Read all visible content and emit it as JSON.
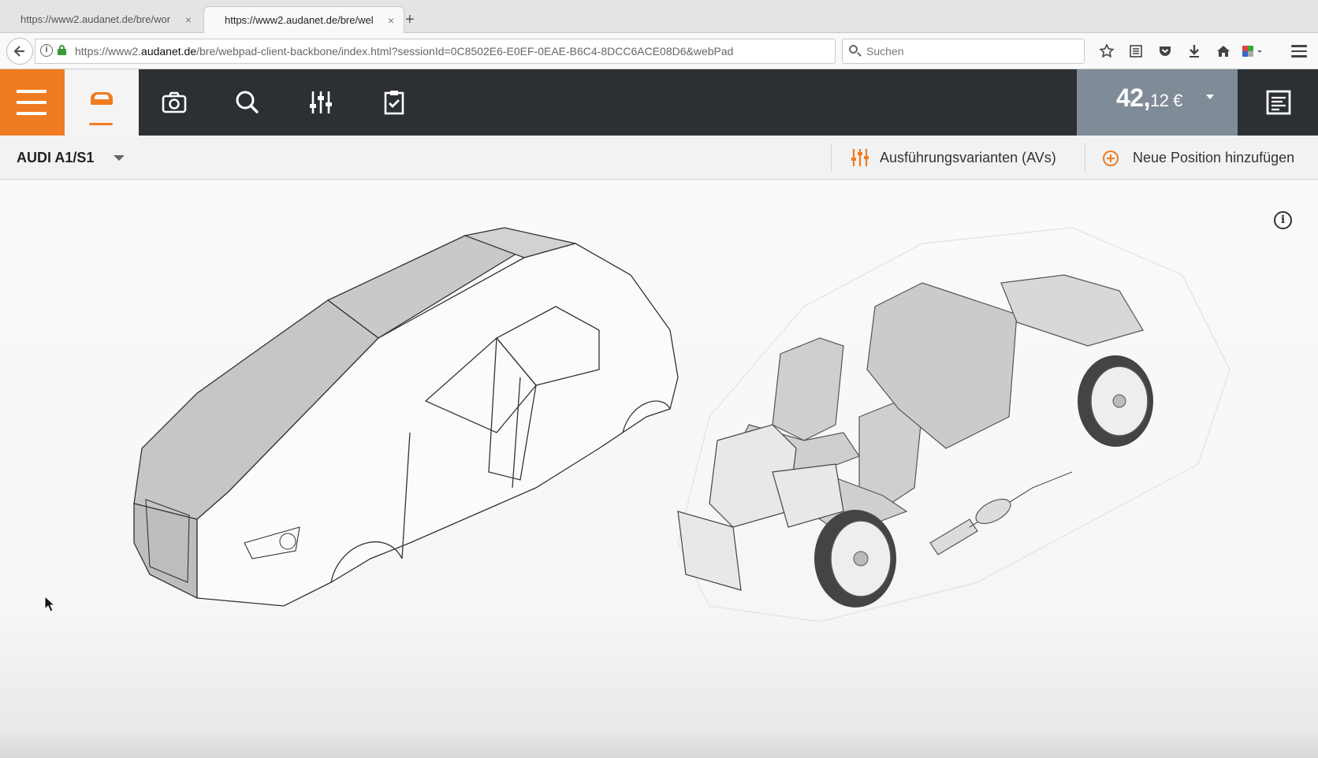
{
  "browser": {
    "tabs": [
      {
        "title": "https://www2.audanet.de/bre/wor",
        "active": false
      },
      {
        "title": "https://www2.audanet.de/bre/wel",
        "active": true
      }
    ],
    "new_tab_glyph": "+",
    "close_glyph": "×",
    "url_prefix": "https://www2.",
    "url_host": "audanet.de",
    "url_rest": "/bre/webpad-client-backbone/index.html?sessionId=0C8502E6-E0EF-0EAE-B6C4-8DCC6ACE08D6&webPad",
    "search_placeholder": "Suchen",
    "toolbar_icons": [
      "bookmark-star-icon",
      "reading-list-icon",
      "pocket-icon",
      "download-icon",
      "home-icon",
      "extension-icon"
    ]
  },
  "app": {
    "accent_color": "#f07c22",
    "header_color": "#2c2f33",
    "price_bg": "#7f8b97",
    "price_main": "42,",
    "price_cents": "12 €",
    "tools": [
      "camera-icon",
      "search-icon",
      "sliders-icon",
      "clipboard-check-icon"
    ],
    "model": "AUDI A1/S1",
    "actions": {
      "variants_label": "Ausführungsvarianten (AVs)",
      "add_position_label": "Neue Position hinzufügen"
    },
    "info_glyph": "i"
  }
}
